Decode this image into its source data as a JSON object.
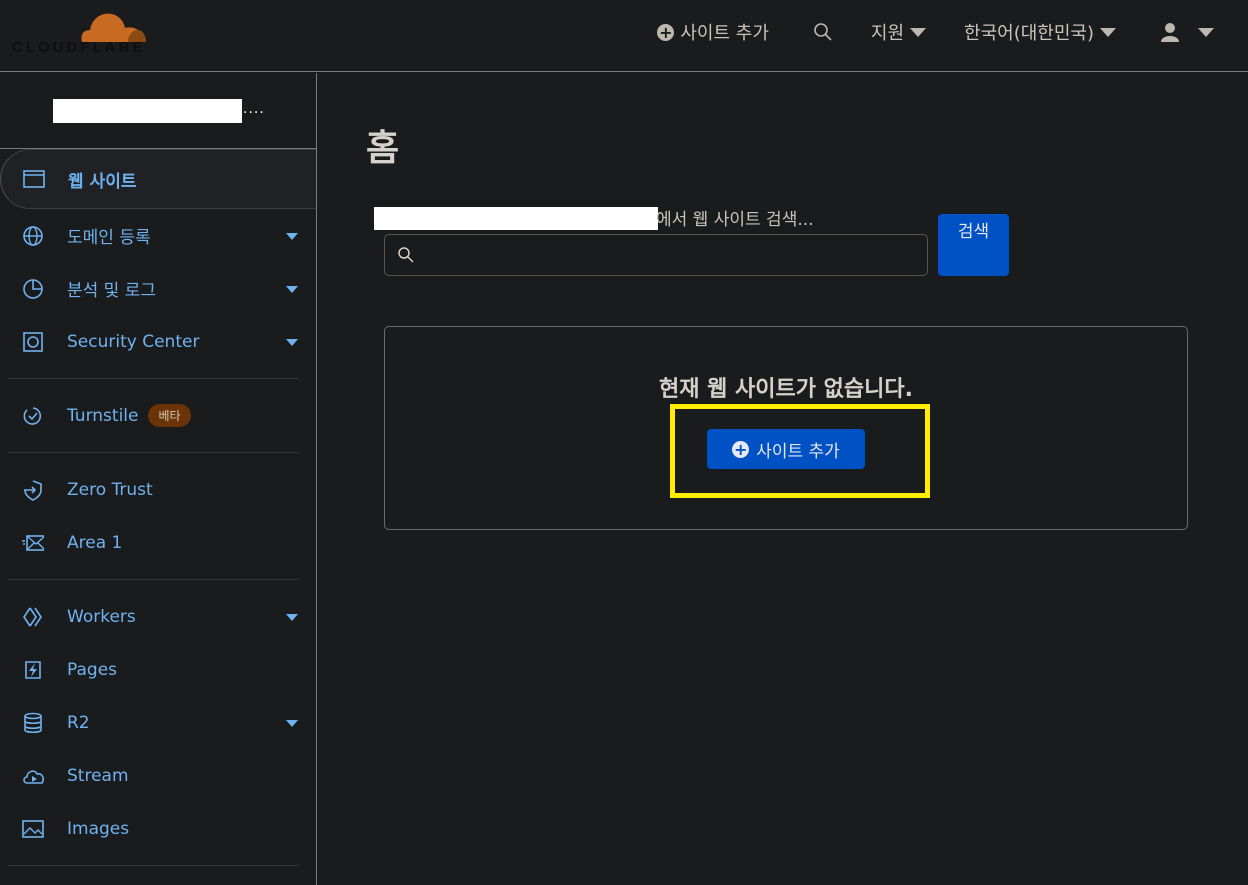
{
  "brand": {
    "logo_text": "CLOUDFLARE",
    "color": "#f38020"
  },
  "header": {
    "add_site": "사이트 추가",
    "support": "지원",
    "language": "한국어(대한민국)"
  },
  "sidebar": {
    "account_suffix": "....",
    "items": [
      {
        "label": "웹 사이트",
        "icon": "browser-window-icon"
      },
      {
        "label": "도메인 등록",
        "icon": "globe-icon"
      },
      {
        "label": "분석 및 로그",
        "icon": "pie-chart-icon"
      },
      {
        "label": "Security Center",
        "icon": "security-icon"
      },
      {
        "label": "Turnstile",
        "icon": "turnstile-icon",
        "badge": "베타"
      },
      {
        "label": "Zero Trust",
        "icon": "shield-icon"
      },
      {
        "label": "Area 1",
        "icon": "envelope-icon"
      },
      {
        "label": "Workers",
        "icon": "workers-icon"
      },
      {
        "label": "Pages",
        "icon": "lightning-icon"
      },
      {
        "label": "R2",
        "icon": "database-icon"
      },
      {
        "label": "Stream",
        "icon": "cloud-play-icon"
      },
      {
        "label": "Images",
        "icon": "image-icon"
      }
    ]
  },
  "main": {
    "title": "홈",
    "search_label": "에서 웹 사이트 검색...",
    "search_value": "",
    "search_button": "검색",
    "empty_message": "현재 웹 사이트가 없습니다.",
    "add_site_button": "사이트 추가",
    "accent": "#0051c3",
    "highlight_color": "#ffee00"
  }
}
